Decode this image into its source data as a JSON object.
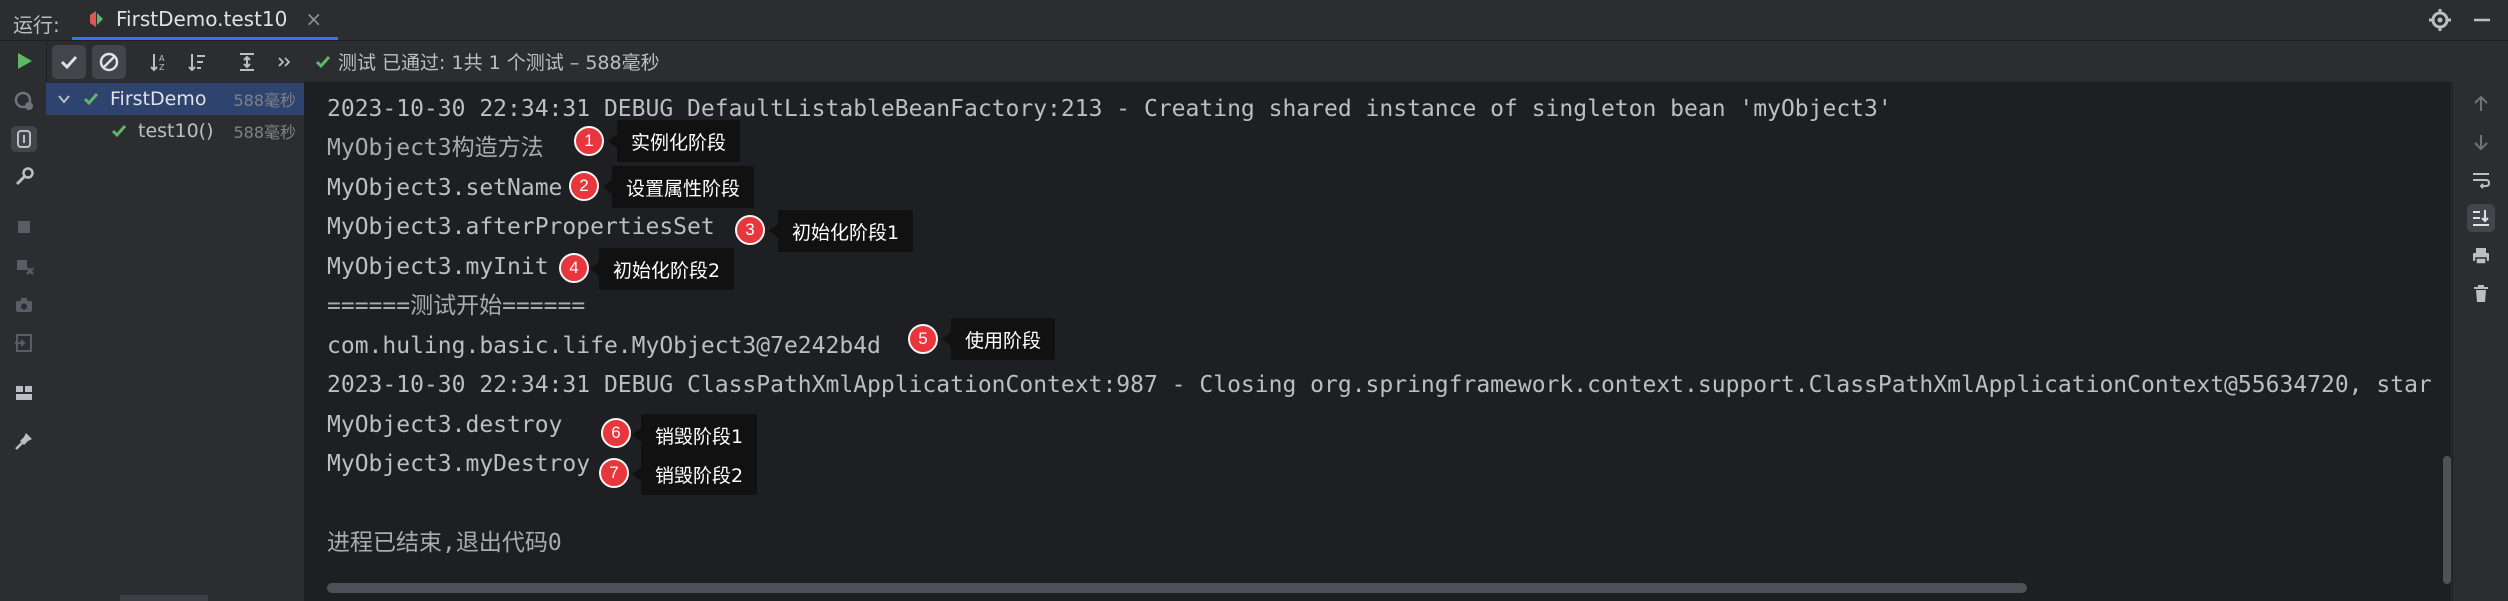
{
  "header": {
    "run_label": "运行:",
    "tab_title": "FirstDemo.test10",
    "tab_close": "×"
  },
  "status": {
    "label": "测试 已通过: 1共 1 个测试 – 588毫秒"
  },
  "tree": {
    "root": {
      "name": "FirstDemo",
      "time": "588毫秒"
    },
    "child": {
      "name": "test10()",
      "time": "588毫秒"
    }
  },
  "console": {
    "lines": [
      "2023-10-30 22:34:31 DEBUG DefaultListableBeanFactory:213 - Creating shared instance of singleton bean 'myObject3'",
      "MyObject3构造方法",
      "MyObject3.setName",
      "MyObject3.afterPropertiesSet",
      "MyObject3.myInit",
      "======测试开始======",
      "com.huling.basic.life.MyObject3@7e242b4d",
      "2023-10-30 22:34:31 DEBUG ClassPathXmlApplicationContext:987 - Closing org.springframework.context.support.ClassPathXmlApplicationContext@55634720, star",
      "MyObject3.destroy",
      "MyObject3.myDestroy",
      "",
      "进程已结束,退出代码0"
    ]
  },
  "annotations": [
    {
      "num": "1",
      "label": "实例化阶段"
    },
    {
      "num": "2",
      "label": "设置属性阶段"
    },
    {
      "num": "3",
      "label": "初始化阶段1"
    },
    {
      "num": "4",
      "label": "初始化阶段2"
    },
    {
      "num": "5",
      "label": "使用阶段"
    },
    {
      "num": "6",
      "label": "销毁阶段1"
    },
    {
      "num": "7",
      "label": "销毁阶段2"
    }
  ],
  "colors": {
    "accent": "#3574f0",
    "pass_green": "#5fb865",
    "badge_red": "#e8363d",
    "console_bg": "#1e1f22",
    "panel_bg": "#2b2d30"
  }
}
